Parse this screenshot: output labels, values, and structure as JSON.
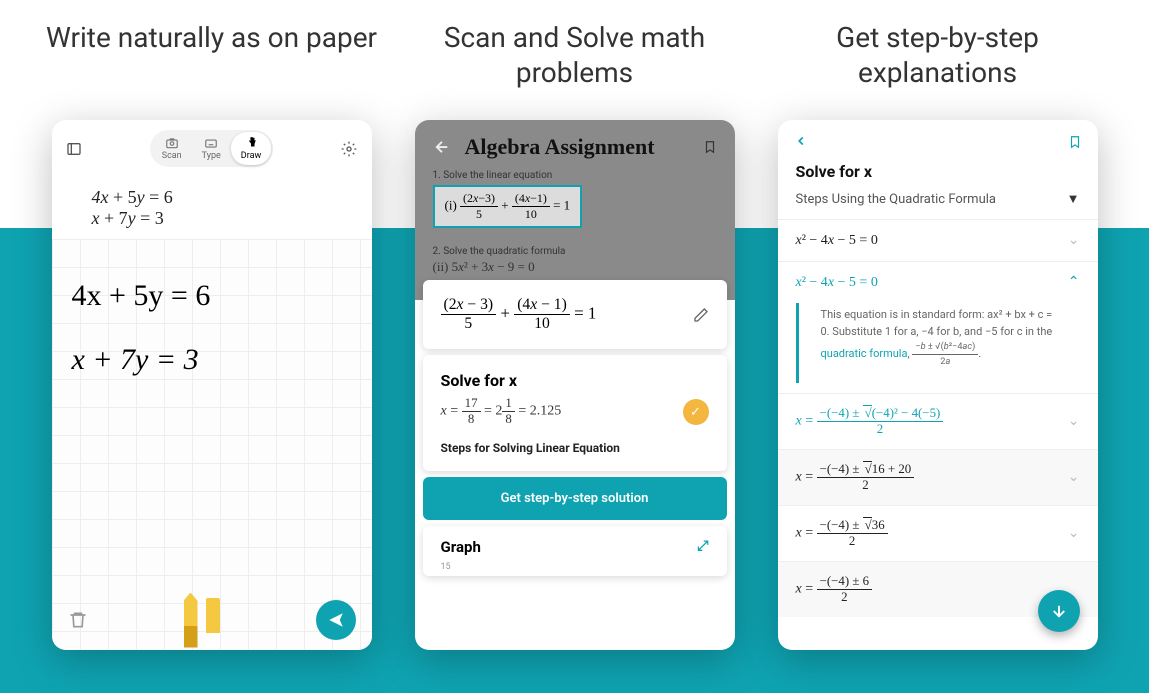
{
  "panels": {
    "write": {
      "headline": "Write naturally as on paper",
      "modes": {
        "scan": "Scan",
        "type": "Type",
        "draw": "Draw"
      },
      "formula_line1": "4x + 5y = 6",
      "formula_line2": "x + 7y = 3",
      "handwritten_line1": "4x + 5y = 6",
      "handwritten_line2": "x + 7y = 3"
    },
    "scan": {
      "headline": "Scan and Solve math problems",
      "title": "Algebra Assignment",
      "problem1_label": "1. Solve the linear equation",
      "problem1_eq": "(i) (2x−3)/5 + (4x−1)/10 = 1",
      "problem2_label": "2. Solve the quadratic formula",
      "problem2_eq": "(ii) 5x² + 3x − 9 = 0",
      "captured_eq": "(2x − 3)/5 + (4x − 1)/10 = 1",
      "solve_header": "Solve for x",
      "solve_answer": "x = 17/8 = 2⅛ = 2.125",
      "steps_link": "Steps for Solving Linear Equation",
      "cta": "Get step-by-step solution",
      "graph_header": "Graph",
      "graph_tick": "15"
    },
    "steps": {
      "headline": "Get step-by-step explanations",
      "title": "Solve for x",
      "method": "Steps Using the Quadratic Formula",
      "row1": "x² − 4x − 5 = 0",
      "row2": "x² − 4x − 5 = 0",
      "explain": "This equation is in standard form: ax² + bx + c = 0. Substitute 1 for a, −4 for b, and −5 for c in the ",
      "explain_link": "quadratic formula",
      "explain_formula": "−b ± √(b²−4ac) / 2a",
      "row3_num": "−(−4) ± √((−4)² − 4(−5))",
      "row3_den": "2",
      "row4_num": "−(−4) ± √(16 + 20)",
      "row4_den": "2",
      "row5_num": "−(−4) ± √36",
      "row5_den": "2",
      "row6_num": "−(−4) ± 6",
      "row6_den": "2"
    }
  }
}
